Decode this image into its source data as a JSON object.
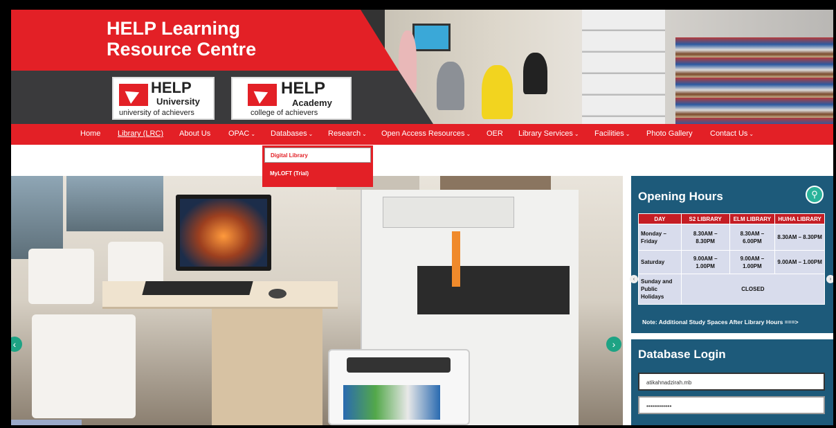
{
  "header": {
    "title_line1": "HELP Learning",
    "title_line2": "Resource Centre",
    "logos": [
      {
        "big": "HELP",
        "small": "University",
        "tagline": "university of achievers"
      },
      {
        "big": "HELP",
        "small": "Academy",
        "tagline": "college of achievers"
      }
    ]
  },
  "nav": {
    "items": [
      {
        "label": "Home"
      },
      {
        "label": "Library (LRC)"
      },
      {
        "label": "About Us"
      },
      {
        "label": "OPAC"
      },
      {
        "label": "Databases"
      },
      {
        "label": "Research"
      },
      {
        "label": "Open Access Resources"
      },
      {
        "label": "OER"
      },
      {
        "label": "Library Services"
      },
      {
        "label": "Facilities"
      },
      {
        "label": "Photo Gallery"
      },
      {
        "label": "Contact Us"
      }
    ],
    "dropdown": [
      "Digital Library",
      "MyLOFT (Trial)"
    ],
    "caret": "⌄"
  },
  "opening_hours": {
    "title": "Opening Hours",
    "headers": [
      "DAY",
      "S2 LIBRARY",
      "ELM LIBRARY",
      "HU/HA LIBRARY"
    ],
    "rows": [
      {
        "day": "Monday – Friday",
        "s2": "8.30AM – 8.30PM",
        "elm": "8.30AM – 6.00PM",
        "huha": "8.30AM – 8.30PM"
      },
      {
        "day": "Saturday",
        "s2": "9.00AM – 1.00PM",
        "elm": "9.00AM – 1.00PM",
        "huha": "9.00AM – 1.00PM"
      },
      {
        "day": "Sunday and Public Holidays",
        "closed": "CLOSED"
      }
    ],
    "note": "Note:  Additional Study Spaces After Library Hours   ===>"
  },
  "database_login": {
    "title": "Database Login",
    "username_value": "atikahnadzirah.mb",
    "password_value": "•••••••••••••"
  },
  "colors": {
    "brand_red": "#e32026",
    "panel_blue": "#1d5a7a",
    "accent_teal": "#1ea384"
  },
  "icons": {
    "slider_prev": "‹",
    "slider_next": "›",
    "search": "⚲"
  }
}
